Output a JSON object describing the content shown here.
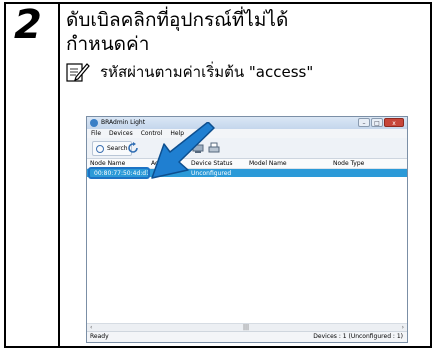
{
  "step": {
    "number": "2"
  },
  "heading": {
    "line1": "ดับเบิลคลิกที่อุปกรณ์ที่ไม่ได้",
    "line2": "กำหนดค่า"
  },
  "note": {
    "text": "รหัสผ่านตามค่าเริ่มต้น \"access\"",
    "icon": "note-pencil-icon"
  },
  "window": {
    "title": "BRAdmin Light",
    "buttons": {
      "minimize": "–",
      "maximize": "□",
      "close": "x"
    },
    "menu": [
      "File",
      "Devices",
      "Control",
      "Help"
    ],
    "toolbar": {
      "search_label": "Search"
    },
    "columns": [
      "Node Name",
      "Address",
      "Device Status",
      "Model Name",
      "Node Type"
    ],
    "rows": [
      {
        "node_name": "00:80:77:50:4d:d1",
        "device_status": "Unconfigured"
      }
    ],
    "scroll": {
      "left": "‹",
      "mid": "|||",
      "right": "›"
    },
    "status": {
      "left": "Ready",
      "right": "Devices : 1   (Unconfigured : 1)"
    }
  },
  "colors": {
    "selection": "#2b9ad8",
    "arrow": "#1f7fd1"
  }
}
